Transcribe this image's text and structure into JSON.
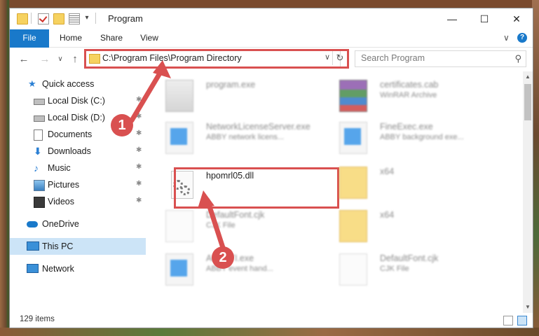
{
  "window": {
    "title": "Program",
    "minimize_glyph": "—",
    "maximize_glyph": "☐",
    "close_glyph": "✕"
  },
  "ribbon": {
    "tabs": [
      "File",
      "Home",
      "Share",
      "View"
    ],
    "expand_glyph": "∨",
    "help_glyph": "?"
  },
  "address": {
    "path": "C:\\Program Files\\Program Directory",
    "dropdown_glyph": "∨",
    "refresh_glyph": "↻",
    "back_glyph": "←",
    "forward_glyph": "→",
    "recent_glyph": "∨",
    "up_glyph": "↑"
  },
  "search": {
    "placeholder": "Search Program",
    "icon_glyph": "⚲"
  },
  "nav_pane": {
    "items": [
      {
        "label": "Quick access",
        "icon": "star-icon"
      },
      {
        "label": "Local Disk (C:)",
        "icon": "drive-icon"
      },
      {
        "label": "Local Disk (D:)",
        "icon": "drive-icon"
      },
      {
        "label": "Documents",
        "icon": "documents-icon"
      },
      {
        "label": "Downloads",
        "icon": "download-icon"
      },
      {
        "label": "Music",
        "icon": "music-icon"
      },
      {
        "label": "Pictures",
        "icon": "pictures-icon"
      },
      {
        "label": "Videos",
        "icon": "videos-icon"
      },
      {
        "label": "OneDrive",
        "icon": "cloud-icon"
      },
      {
        "label": "This PC",
        "icon": "computer-icon"
      },
      {
        "label": "Network",
        "icon": "network-icon"
      }
    ],
    "pin_glyph": "📌"
  },
  "files": [
    {
      "name": "program.exe",
      "sub": ""
    },
    {
      "name": "certificates.cab",
      "sub": "WinRAR Archive"
    },
    {
      "name": "NetworkLicenseServer.exe",
      "sub": "ABBY network licens..."
    },
    {
      "name": "FineExec.exe",
      "sub": "ABBY background exe..."
    },
    {
      "name": "hpomrl05.dll",
      "sub": ""
    },
    {
      "name": "x64",
      "sub": ""
    },
    {
      "name": "DefaultFont.cjk",
      "sub": "CJK File"
    },
    {
      "name": "x64",
      "sub": ""
    },
    {
      "name": "ABBYTI.exe",
      "sub": "ABBY event hand..."
    },
    {
      "name": "DefaultFont.cjk",
      "sub": "CJK File"
    }
  ],
  "status": {
    "count": "129 items"
  },
  "callouts": [
    "1",
    "2"
  ],
  "colors": {
    "accent": "#1979ca",
    "highlight": "#d95050",
    "selected": "#cce4f7"
  }
}
